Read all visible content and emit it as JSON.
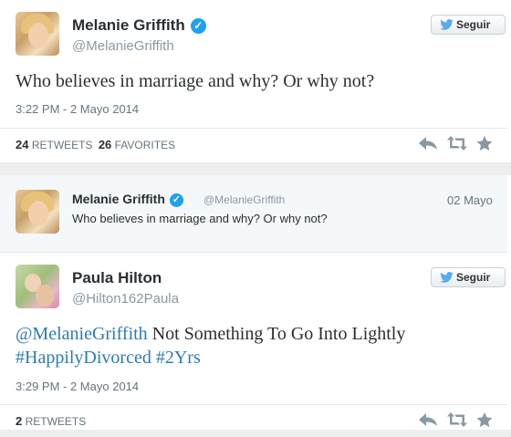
{
  "tweet1": {
    "name": "Melanie Griffith",
    "handle": "@MelanieGriffith",
    "follow_label": "Seguir",
    "text": "Who believes in marriage and why? Or why not?",
    "timestamp": "3:22 PM - 2 Mayo 2014",
    "retweets_count": "24",
    "retweets_label": "RETWEETS",
    "favorites_count": "26",
    "favorites_label": "FAVORITES"
  },
  "reply_to": {
    "name": "Melanie Griffith",
    "handle": "@MelanieGriffith",
    "date": "02 Mayo",
    "text": "Who believes in marriage and why? Or why not?"
  },
  "tweet2": {
    "name": "Paula Hilton",
    "handle": "@Hilton162Paula",
    "follow_label": "Seguir",
    "mention": "@MelanieGriffith",
    "text_rest": " Not Something To Go Into Lightly",
    "hashtag1": "#HappilyDivorced",
    "hashtag2": "#2Yrs",
    "timestamp": "3:29 PM - 2 Mayo 2014",
    "retweets_count": "2",
    "retweets_label": "RETWEETS"
  },
  "icons": [
    "verified-icon",
    "twitter-bird-icon",
    "reply-icon",
    "retweet-icon",
    "favorite-star-icon"
  ],
  "colors": {
    "link": "#2b7bb9",
    "verified": "#1da1f2",
    "meta": "#66757f",
    "background_gap": "#eeeeee"
  }
}
